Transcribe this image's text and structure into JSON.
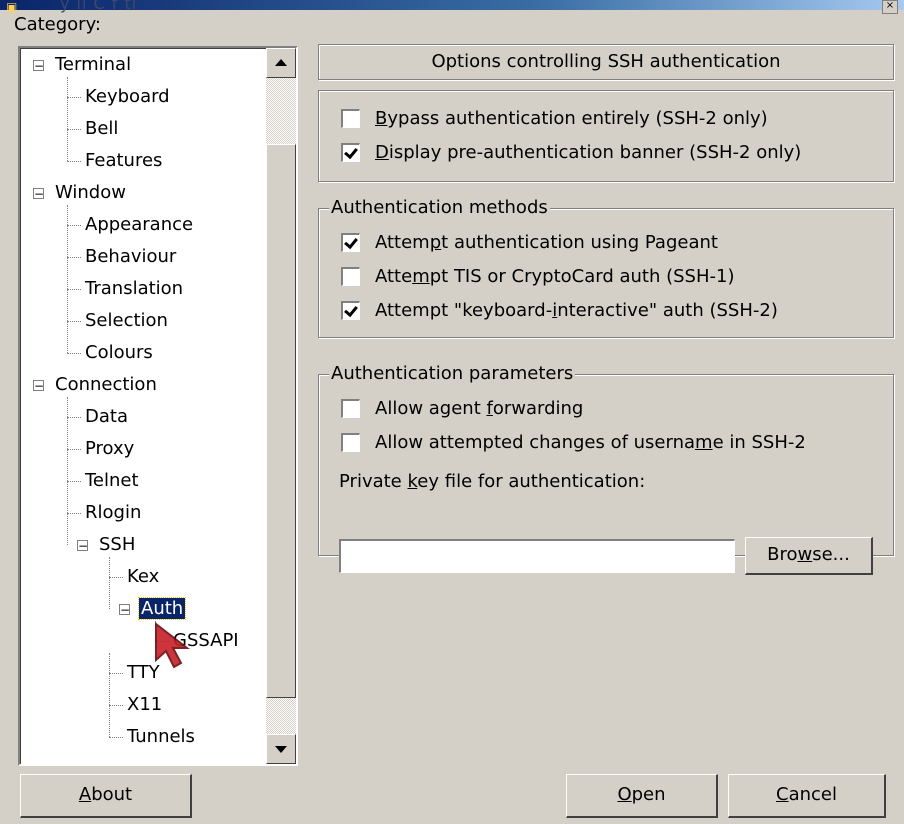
{
  "window": {
    "title_fragment": "y       ll  C  f                      ti"
  },
  "category_label": "Category:",
  "tree": {
    "items": [
      {
        "label": "Terminal",
        "level": 0,
        "expander": "−"
      },
      {
        "label": "Keyboard",
        "level": 1
      },
      {
        "label": "Bell",
        "level": 1
      },
      {
        "label": "Features",
        "level": 1
      },
      {
        "label": "Window",
        "level": 0,
        "expander": "−"
      },
      {
        "label": "Appearance",
        "level": 1
      },
      {
        "label": "Behaviour",
        "level": 1
      },
      {
        "label": "Translation",
        "level": 1
      },
      {
        "label": "Selection",
        "level": 1
      },
      {
        "label": "Colours",
        "level": 1
      },
      {
        "label": "Connection",
        "level": 0,
        "expander": "−"
      },
      {
        "label": "Data",
        "level": 1
      },
      {
        "label": "Proxy",
        "level": 1
      },
      {
        "label": "Telnet",
        "level": 1
      },
      {
        "label": "Rlogin",
        "level": 1
      },
      {
        "label": "SSH",
        "level": 1,
        "expander": "−"
      },
      {
        "label": "Kex",
        "level": 2
      },
      {
        "label": "Auth",
        "level": 2,
        "expander": "−",
        "selected": true
      },
      {
        "label": "GSSAPI",
        "level": 3
      },
      {
        "label": "TTY",
        "level": 2
      },
      {
        "label": "X11",
        "level": 2
      },
      {
        "label": "Tunnels",
        "level": 2
      }
    ]
  },
  "panel": {
    "header": "Options controlling SSH authentication",
    "bypass_group": {
      "items": [
        {
          "pre": "",
          "key": "B",
          "post": "ypass authentication entirely (SSH-2 only)",
          "checked": false
        },
        {
          "pre": "",
          "key": "D",
          "post": "isplay pre-authentication banner (SSH-2 only)",
          "checked": true
        }
      ]
    },
    "methods_group": {
      "title": "Authentication methods",
      "items": [
        {
          "pre": "Attem",
          "key": "p",
          "post": "t authentication using Pageant",
          "checked": true
        },
        {
          "pre": "Atte",
          "key": "m",
          "post": "pt TIS or CryptoCard auth (SSH-1)",
          "checked": false
        },
        {
          "pre": "Attempt \"keyboard-",
          "key": "i",
          "post": "nteractive\" auth (SSH-2)",
          "checked": true
        }
      ]
    },
    "params_group": {
      "title": "Authentication parameters",
      "items": [
        {
          "pre": "Allow agent ",
          "key": "f",
          "post": "orwarding",
          "checked": false
        },
        {
          "pre": "Allow attempted changes of userna",
          "key": "m",
          "post": "e in SSH-2",
          "checked": false
        }
      ],
      "keyfile_label_pre": "Private ",
      "keyfile_label_key": "k",
      "keyfile_label_post": "ey file for authentication:",
      "keyfile_value": "",
      "browse_pre": "Bro",
      "browse_key": "w",
      "browse_post": "se..."
    }
  },
  "footer": {
    "about_key": "A",
    "about_post": "bout",
    "open_key": "O",
    "open_post": "pen",
    "cancel_key": "C",
    "cancel_post": "ancel"
  }
}
